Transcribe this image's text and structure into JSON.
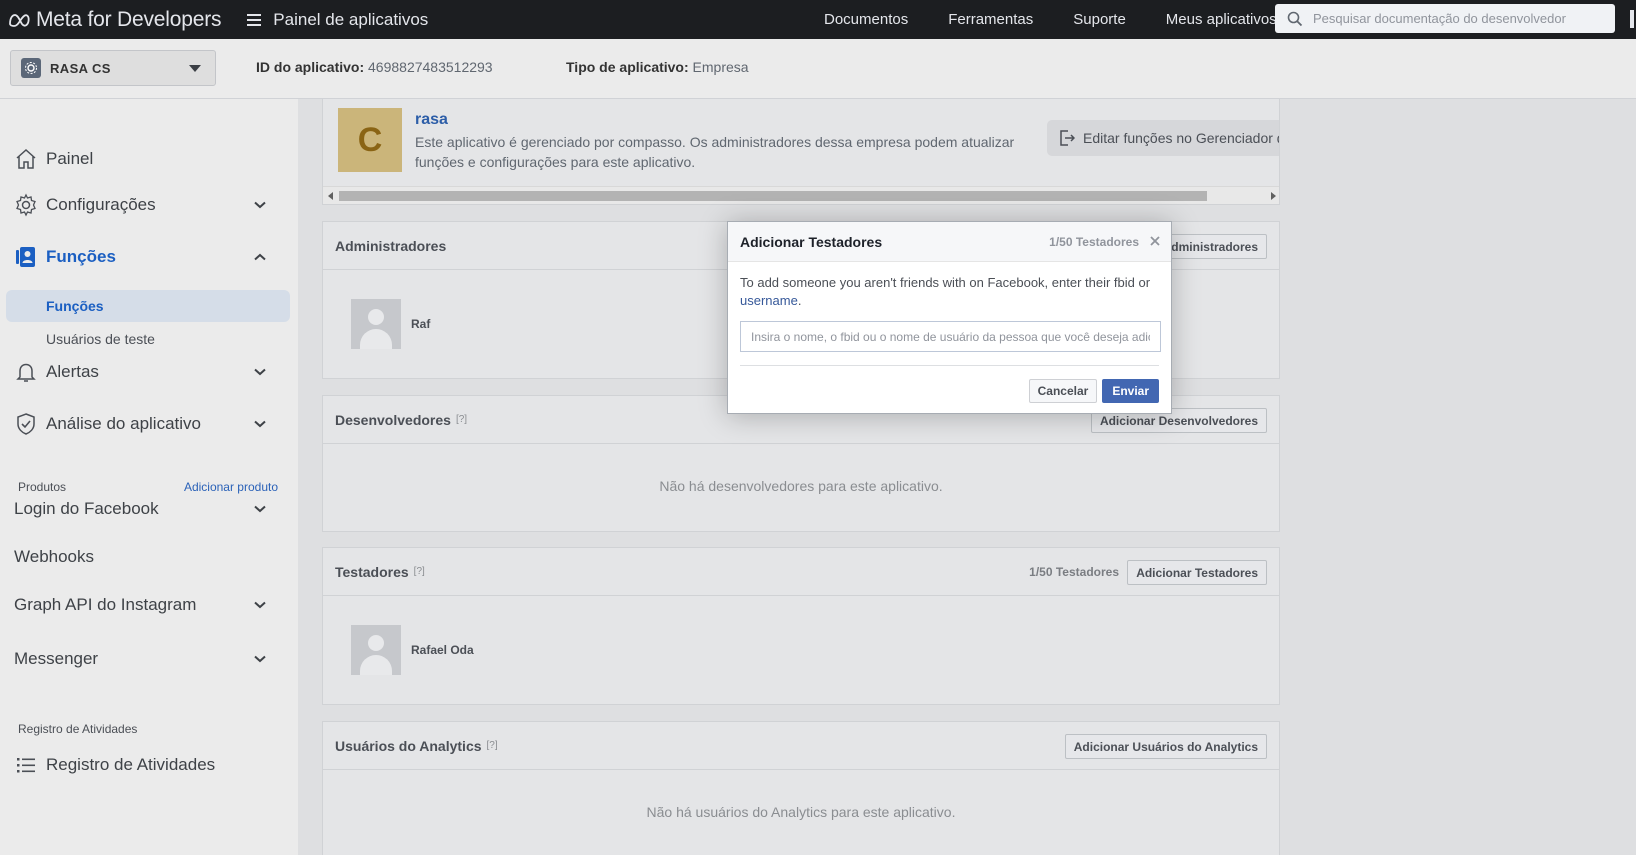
{
  "topbar": {
    "brand": "Meta for Developers",
    "menu_label": "Painel de aplicativos",
    "nav": [
      "Documentos",
      "Ferramentas",
      "Suporte",
      "Meus aplicativos"
    ],
    "search_placeholder": "Pesquisar documentação do desenvolvedor"
  },
  "appbar": {
    "app_name": "RASA CS",
    "app_id_label": "ID do aplicativo:",
    "app_id": "4698827483512293",
    "app_type_label": "Tipo de aplicativo:",
    "app_type": "Empresa"
  },
  "sidebar": {
    "painel": "Painel",
    "configuracoes": "Configurações",
    "funcoes": "Funções",
    "sub_funcoes": "Funções",
    "sub_usuarios_teste": "Usuários de teste",
    "alertas": "Alertas",
    "analise": "Análise do aplicativo",
    "produtos_label": "Produtos",
    "adicionar_produto": "Adicionar produto",
    "login_facebook": "Login do Facebook",
    "webhooks": "Webhooks",
    "graph_instagram": "Graph API do Instagram",
    "messenger": "Messenger",
    "registro_label": "Registro de Atividades",
    "registro_item": "Registro de Atividades"
  },
  "business": {
    "logo_letter": "C",
    "name": "rasa",
    "description": "Este aplicativo é gerenciado por compasso. Os administradores dessa empresa podem atualizar funções e configurações para este aplicativo.",
    "edit_button": "Editar funções no Gerenciador d"
  },
  "cards": {
    "admins": {
      "title": "Administradores",
      "button": "Adicionar Administradores",
      "person": "Rafael Oda",
      "person_partial": "Raf"
    },
    "devs": {
      "title": "Desenvolvedores",
      "q": "[?]",
      "button": "Adicionar Desenvolvedores",
      "empty": "Não há desenvolvedores para este aplicativo."
    },
    "testers": {
      "title": "Testadores",
      "q": "[?]",
      "count": "1/50 Testadores",
      "button": "Adicionar Testadores",
      "person": "Rafael Oda"
    },
    "analytics": {
      "title": "Usuários do Analytics",
      "q": "[?]",
      "button": "Adicionar Usuários do Analytics",
      "empty": "Não há usuários do Analytics para este aplicativo."
    }
  },
  "modal": {
    "title": "Adicionar Testadores",
    "count": "1/50 Testadores",
    "text_before": "To add someone you aren't friends with on Facebook, enter their fbid or ",
    "text_link": "username",
    "text_after": ".",
    "input_placeholder": "Insira o nome, o fbid ou o nome de usuário da pessoa que você deseja adicionar",
    "cancel": "Cancelar",
    "send": "Enviar"
  },
  "colors": {
    "topbar": "#1c1e21",
    "accent_blue": "#1b5fc2",
    "primary_button": "#4267b2"
  },
  "icons": [
    "meta-logo-icon",
    "menu-icon",
    "search-icon",
    "app-icon",
    "home-icon",
    "gear-icon",
    "roles-icon",
    "bell-icon",
    "shield-check-icon",
    "list-icon",
    "chevron-down-icon",
    "chevron-up-icon",
    "exit-icon",
    "close-icon"
  ]
}
